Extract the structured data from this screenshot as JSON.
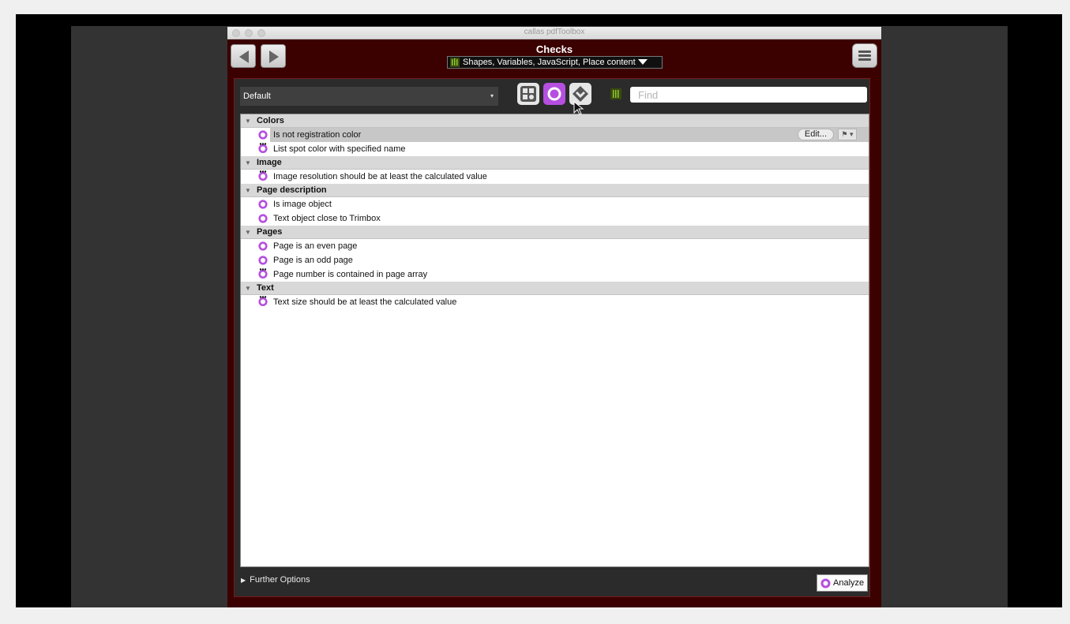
{
  "window": {
    "title": "callas pdfToolbox"
  },
  "header": {
    "title": "Checks",
    "profile": "Shapes, Variables, JavaScript, Place content"
  },
  "toolbar": {
    "library_select": "Default",
    "find_placeholder": "Find"
  },
  "colors": {
    "window_bg": "#3b0000",
    "accent_purple": "#b64fe0",
    "library_green": "#8ecb2c"
  },
  "list": {
    "categories": [
      {
        "name": "Colors",
        "items": [
          {
            "label": "Is not registration color",
            "icon": "check-ring-icon",
            "selected": true
          },
          {
            "label": "List spot color with specified name",
            "icon": "check-ring-variable-icon"
          }
        ]
      },
      {
        "name": "Image",
        "items": [
          {
            "label": "Image resolution should be at least the calculated value",
            "icon": "check-ring-variable-icon"
          }
        ]
      },
      {
        "name": "Page description",
        "items": [
          {
            "label": "Is image object",
            "icon": "check-ring-icon"
          },
          {
            "label": "Text object close to Trimbox",
            "icon": "check-ring-icon"
          }
        ]
      },
      {
        "name": "Pages",
        "items": [
          {
            "label": "Page is an even page",
            "icon": "check-ring-icon"
          },
          {
            "label": "Page is an odd page",
            "icon": "check-ring-icon"
          },
          {
            "label": "Page number is contained in page array",
            "icon": "check-ring-variable-icon"
          }
        ]
      },
      {
        "name": "Text",
        "items": [
          {
            "label": "Text size should be at least the calculated value",
            "icon": "check-ring-variable-icon"
          }
        ]
      }
    ],
    "edit_label": "Edit...",
    "flag_label": "⚑ ▾"
  },
  "footer": {
    "further_options": "Further Options",
    "analyze_label": "Analyze"
  }
}
